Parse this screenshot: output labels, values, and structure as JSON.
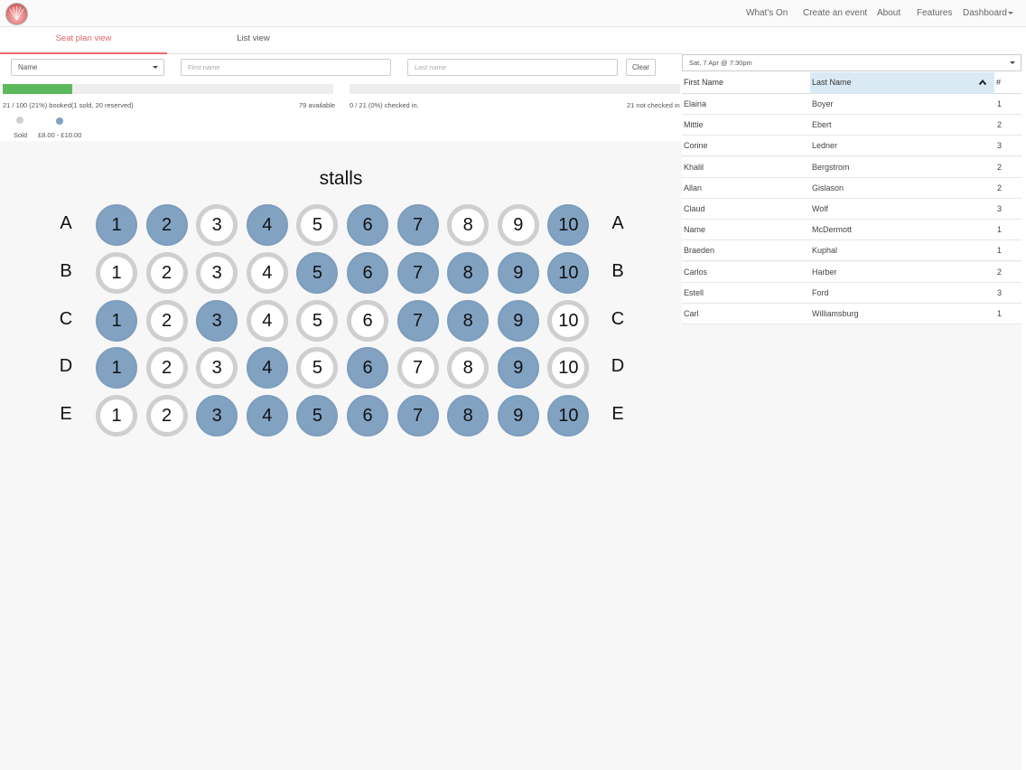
{
  "nav": {
    "links": [
      "What's On",
      "Create an event",
      "About",
      "Features",
      "Dashboard"
    ]
  },
  "tabs": {
    "seat_plan": "Seat plan view",
    "list": "List view"
  },
  "filters": {
    "field_select": "Name",
    "first_name_placeholder": "First name",
    "last_name_placeholder": "Last name",
    "clear_label": "Clear"
  },
  "booking": {
    "booked_fraction": 0.21,
    "booked_text": "21 / 100 (21%) booked(1 sold, 20 reserved)",
    "available_text": "79 available",
    "checkin_fraction": 0,
    "checkin_text": "0 / 21 (0%) checked in.",
    "not_checked_text": "21 not checked in"
  },
  "legend": [
    {
      "label": "Sold",
      "color": "#cfcfcf"
    },
    {
      "label": "£8.00 - £10.00",
      "color": "#82a2c2"
    }
  ],
  "colors": {
    "accent": "#ea6c6c",
    "progress": "#5cb85c",
    "booked_seat": "#82a2c2",
    "free_seat_ring": "#cfcfcf",
    "sorted_header": "#d9eaf5"
  },
  "seatplan": {
    "section": "stalls",
    "rows": [
      {
        "label": "A",
        "seats": [
          1,
          2,
          3,
          4,
          5,
          6,
          7,
          8,
          9,
          10
        ],
        "booked": [
          1,
          2,
          4,
          6,
          7,
          10
        ]
      },
      {
        "label": "B",
        "seats": [
          1,
          2,
          3,
          4,
          5,
          6,
          7,
          8,
          9,
          10
        ],
        "booked": [
          5,
          6,
          7,
          8,
          9,
          10
        ]
      },
      {
        "label": "C",
        "seats": [
          1,
          2,
          3,
          4,
          5,
          6,
          7,
          8,
          9,
          10
        ],
        "booked": [
          1,
          3,
          7,
          8,
          9
        ]
      },
      {
        "label": "D",
        "seats": [
          1,
          2,
          3,
          4,
          5,
          6,
          7,
          8,
          9,
          10
        ],
        "booked": [
          1,
          4,
          6,
          9
        ]
      },
      {
        "label": "E",
        "seats": [
          1,
          2,
          3,
          4,
          5,
          6,
          7,
          8,
          9,
          10
        ],
        "booked": [
          3,
          4,
          5,
          6,
          7,
          8,
          9,
          10
        ]
      }
    ]
  },
  "performance": {
    "selected": "Sat, 7 Apr @ 7:30pm"
  },
  "attendees": {
    "headers": [
      "First Name",
      "Last Name",
      "#"
    ],
    "sort_icon": "chevron-up-icon",
    "rows": [
      {
        "first": "Elaina",
        "last": "Boyer",
        "count": "1"
      },
      {
        "first": "Mittie",
        "last": "Ebert",
        "count": "2"
      },
      {
        "first": "Corine",
        "last": "Ledner",
        "count": "3"
      },
      {
        "first": "Khalil",
        "last": "Bergstrom",
        "count": "2"
      },
      {
        "first": "Allan",
        "last": "Gislason",
        "count": "2"
      },
      {
        "first": "Claud",
        "last": "Wolf",
        "count": "3"
      },
      {
        "first": "Name",
        "last": "McDermott",
        "count": "1"
      },
      {
        "first": "Braeden",
        "last": "Kuphal",
        "count": "1"
      },
      {
        "first": "Carlos",
        "last": "Harber",
        "count": "2"
      },
      {
        "first": "Estell",
        "last": "Ford",
        "count": "3"
      },
      {
        "first": "Carl",
        "last": "Williamsburg",
        "count": "1"
      }
    ]
  }
}
